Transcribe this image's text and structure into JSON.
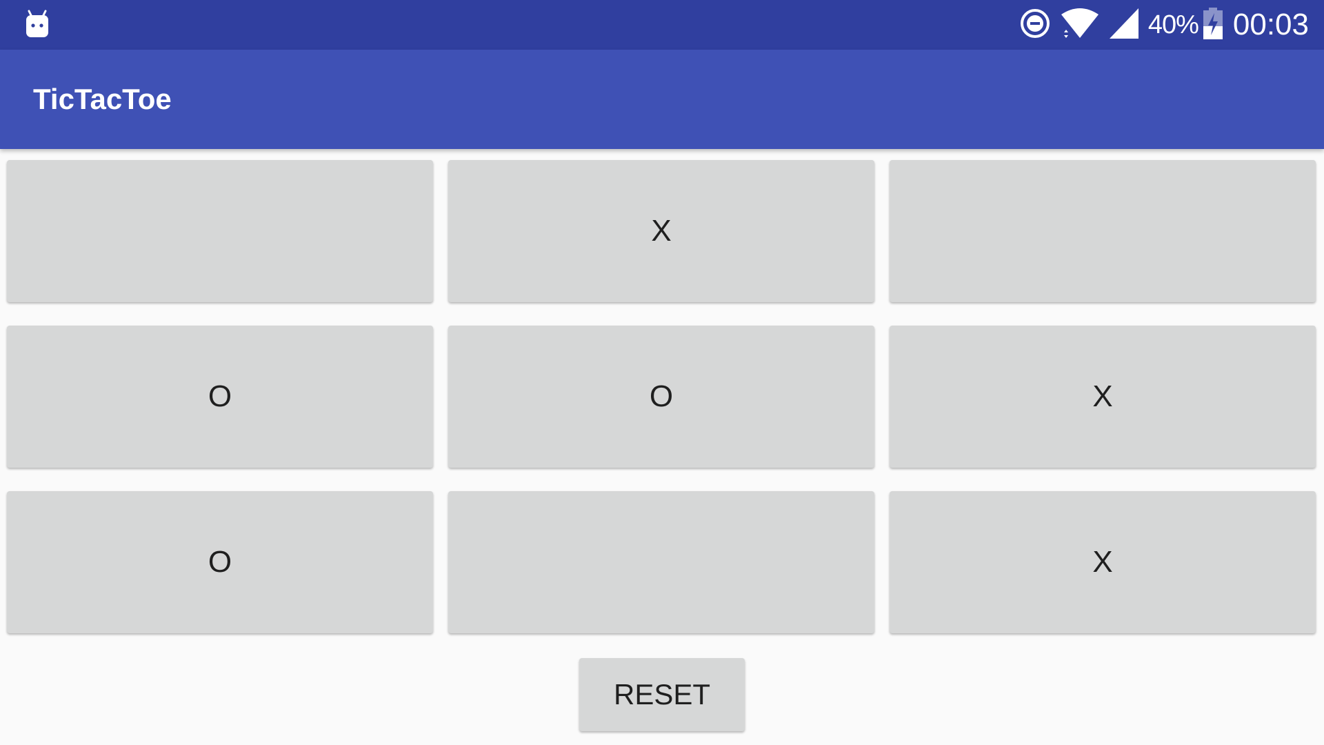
{
  "status_bar": {
    "notification_icon": "android-debug-icon",
    "dnd_icon": "do-not-disturb-icon",
    "wifi_icon": "wifi-icon",
    "signal_icon": "cell-signal-icon",
    "battery_percent": "40%",
    "battery_icon": "battery-charging-icon",
    "battery_level": 0.4,
    "clock": "00:03"
  },
  "app_bar": {
    "title": "TicTacToe"
  },
  "board": {
    "rows": [
      [
        "",
        "X",
        ""
      ],
      [
        "O",
        "O",
        "X"
      ],
      [
        "O",
        "",
        "X"
      ]
    ]
  },
  "actions": {
    "reset_label": "RESET"
  },
  "colors": {
    "status_bar": "#303f9f",
    "app_bar": "#3f51b5",
    "background": "#fafafa",
    "button": "#d6d7d7",
    "text": "#1f1f1f"
  }
}
